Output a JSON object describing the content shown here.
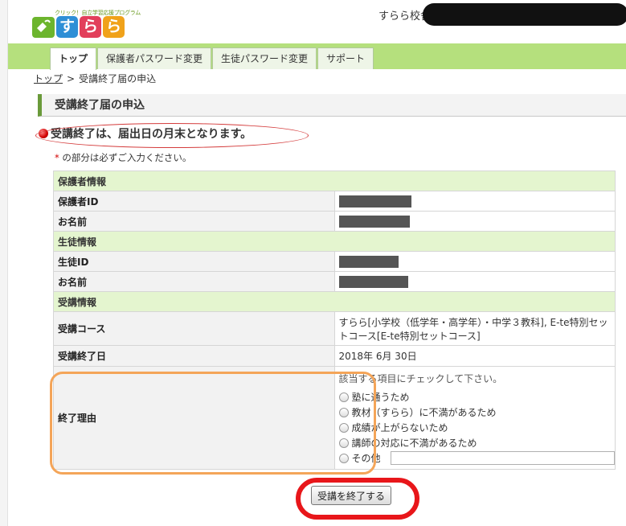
{
  "header": {
    "logo_tagline": "クリック！自立学習応援プログラム",
    "logo_chars": [
      "す",
      "ら",
      "ら"
    ],
    "school_name": "すらら校舎"
  },
  "nav": {
    "tabs": [
      {
        "label": "トップ",
        "active": true
      },
      {
        "label": "保護者パスワード変更",
        "active": false
      },
      {
        "label": "生徒パスワード変更",
        "active": false
      },
      {
        "label": "サポート",
        "active": false
      }
    ]
  },
  "breadcrumb": {
    "home": "トップ",
    "separator": ">",
    "current": "受講終了届の申込"
  },
  "page": {
    "title": "受講終了届の申込",
    "notice": "受講終了は、届出日の月末となります。",
    "required_asterisk": "*",
    "required_note": "の部分は必ずご入力ください。"
  },
  "form": {
    "guardian_section": "保護者情報",
    "guardian_id_label": "保護者ID",
    "guardian_name_label": "お名前",
    "student_section": "生徒情報",
    "student_id_label": "生徒ID",
    "student_name_label": "お名前",
    "course_section": "受講情報",
    "course_label": "受講コース",
    "course_value": "すらら[小学校（低学年・高学年）・中学３教科], E-te特別セットコース[E-te特別セットコース]",
    "end_date_label": "受講終了日",
    "end_date_value": "2018年 6月 30日",
    "reason_label": "終了理由",
    "reason_hint": "該当する項目にチェックして下さい。",
    "reasons": [
      "塾に通うため",
      "教材（すらら）に不満があるため",
      "成績が上がらないため",
      "講師の対応に不満があるため",
      "その他"
    ],
    "other_value": ""
  },
  "submit": {
    "label": "受講を終了する"
  },
  "colors": {
    "nav_green": "#b5e07d",
    "section_green": "#e4f5cf",
    "annotation_orange": "#f4a559",
    "annotation_red": "#e8161a"
  }
}
